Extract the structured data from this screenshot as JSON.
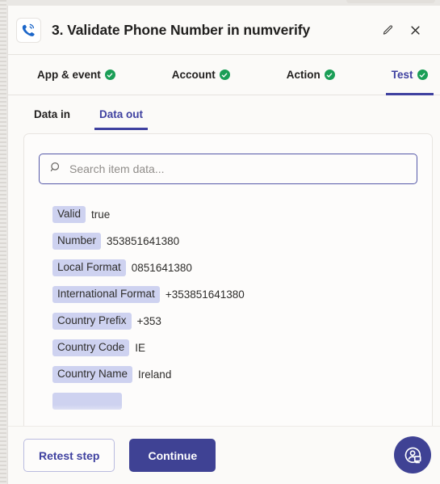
{
  "step": {
    "title": "3. Validate Phone Number in numverify",
    "app_icon": "phone-ring-icon",
    "edit_icon": "pencil-icon",
    "close_icon": "close-icon"
  },
  "step_tabs": [
    {
      "label": "App & event",
      "status_icon": "check-circle-icon",
      "active": false
    },
    {
      "label": "Account",
      "status_icon": "check-circle-icon",
      "active": false
    },
    {
      "label": "Action",
      "status_icon": "check-circle-icon",
      "active": false
    },
    {
      "label": "Test",
      "status_icon": "check-circle-icon",
      "active": true
    }
  ],
  "data_tabs": [
    {
      "label": "Data in",
      "active": false
    },
    {
      "label": "Data out",
      "active": true
    }
  ],
  "search": {
    "placeholder": "Search item data...",
    "value": "",
    "icon": "search-icon"
  },
  "data_rows": [
    {
      "label": "Valid",
      "value": "true"
    },
    {
      "label": "Number",
      "value": "353851641380"
    },
    {
      "label": "Local Format",
      "value": "0851641380"
    },
    {
      "label": "International Format",
      "value": "+353851641380"
    },
    {
      "label": "Country Prefix",
      "value": "+353"
    },
    {
      "label": "Country Code",
      "value": "IE"
    },
    {
      "label": "Country Name",
      "value": "Ireland"
    }
  ],
  "footer": {
    "retest_label": "Retest step",
    "continue_label": "Continue"
  },
  "help": {
    "icon": "support-chat-icon"
  },
  "colors": {
    "accent": "#3f4294",
    "accent_text": "#3f41a0",
    "label_pill": "#ced2f0",
    "success": "#1a9e56",
    "panel_bg": "#fbfaf8",
    "card_bg": "#fdfcfb"
  }
}
